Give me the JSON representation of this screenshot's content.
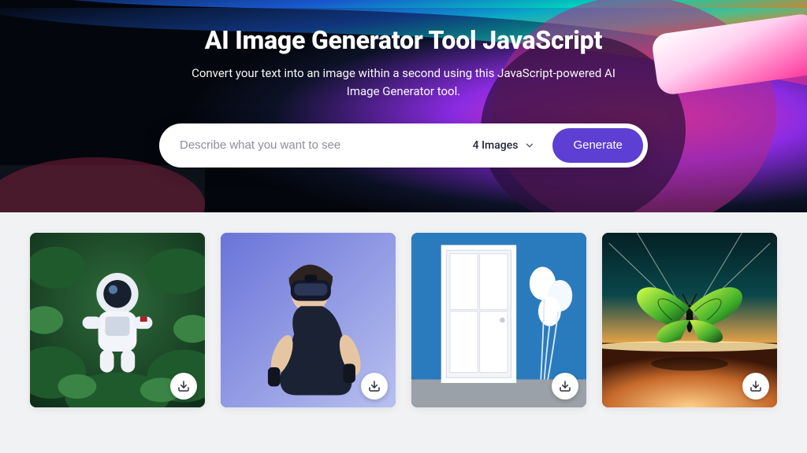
{
  "hero": {
    "title": "AI Image Generator Tool JavaScript",
    "subtitle": "Convert your text into an image within a second using this JavaScript-powered AI Image Generator tool."
  },
  "prompt": {
    "placeholder": "Describe what you want to see",
    "value": "",
    "count_label": "4 Images",
    "generate_label": "Generate"
  },
  "gallery": {
    "items": [
      {
        "alt": "astronaut in foliage"
      },
      {
        "alt": "man wearing VR headset"
      },
      {
        "alt": "white door with balloons on blue wall"
      },
      {
        "alt": "glowing butterfly over horizon"
      }
    ],
    "download_label": "Download"
  },
  "colors": {
    "accent": "#5d3fd3",
    "page_bg": "#f1f2f4"
  }
}
